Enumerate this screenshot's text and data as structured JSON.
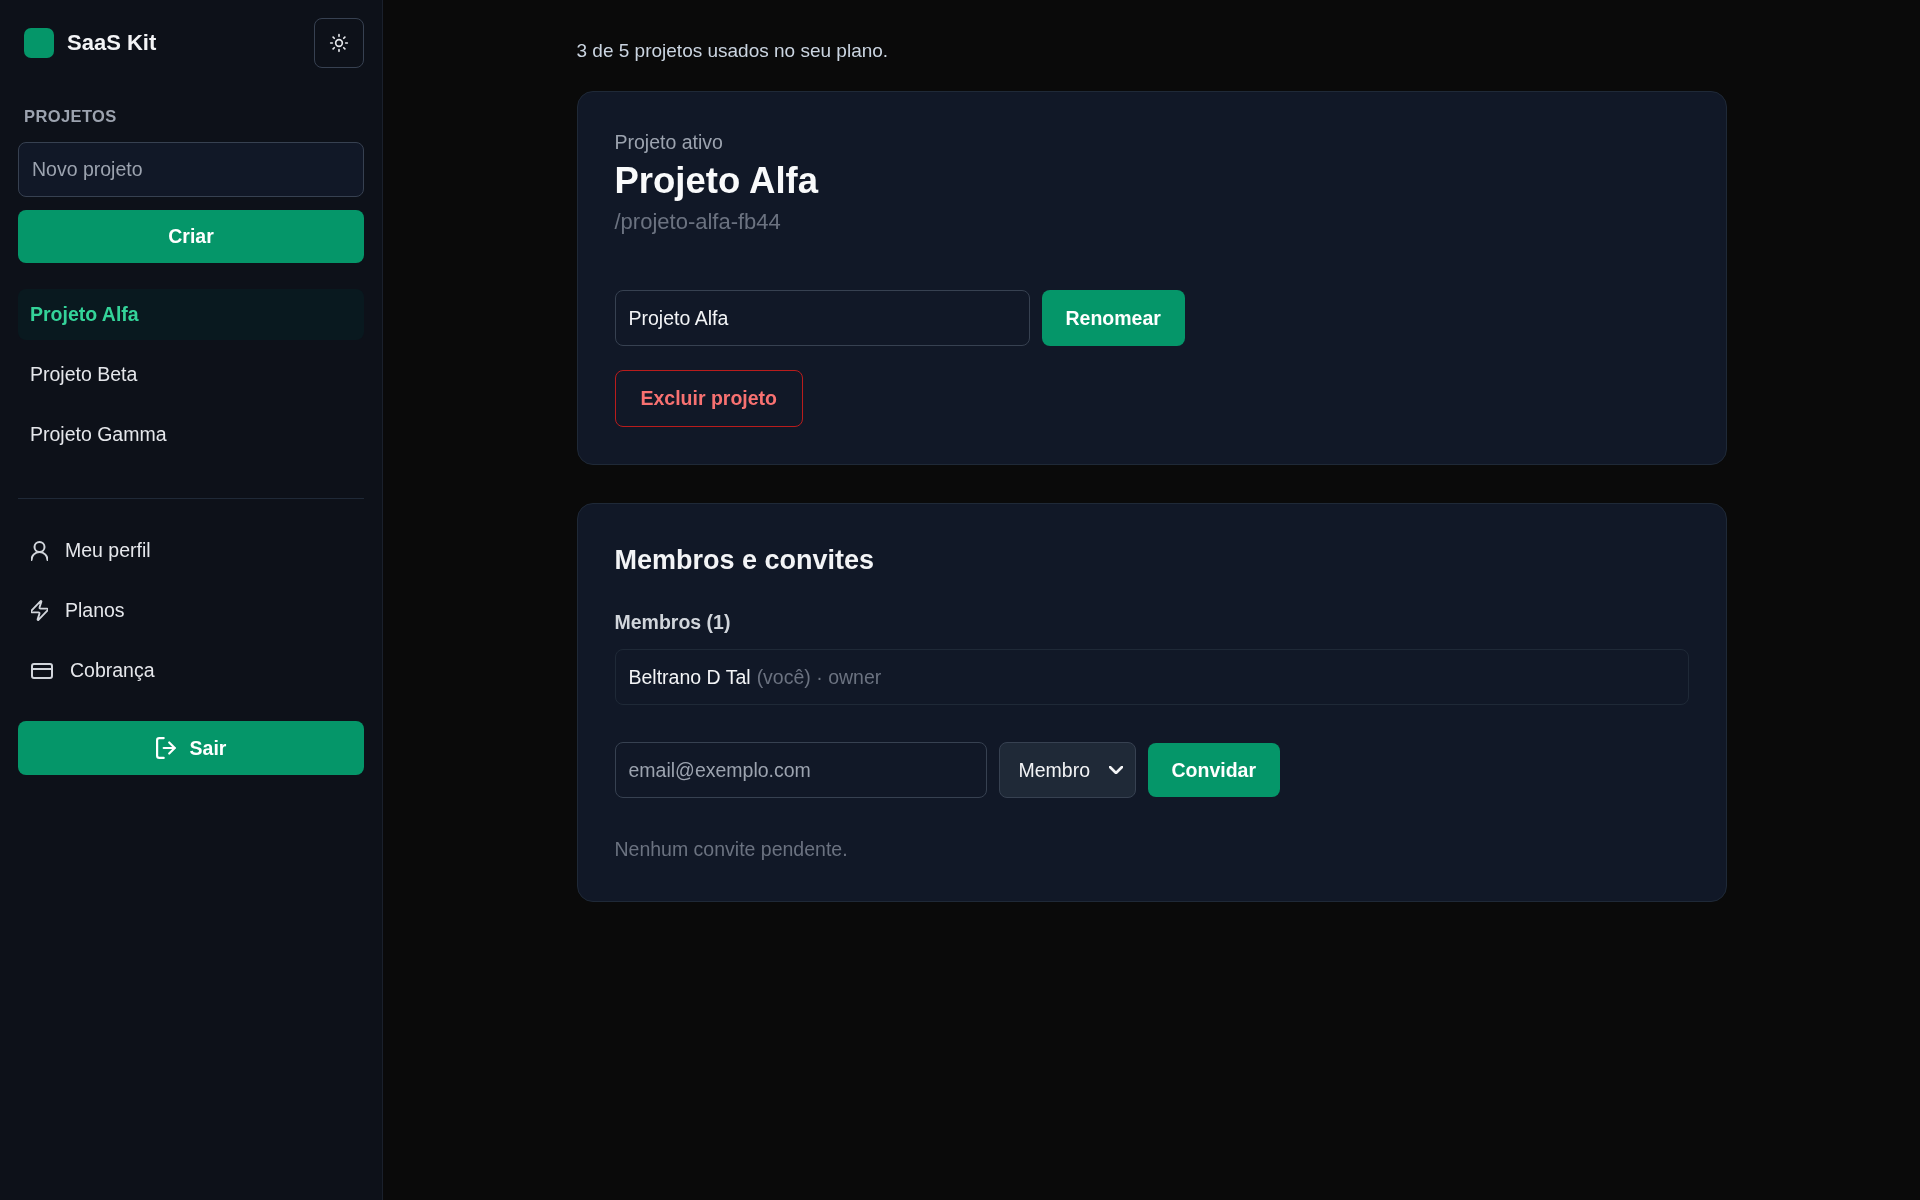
{
  "sidebar": {
    "brand": "SaaS Kit",
    "section_label": "PROJETOS",
    "new_project": {
      "placeholder": "Novo projeto"
    },
    "create_button": "Criar",
    "projects": [
      {
        "label": "Projeto Alfa",
        "selected": true
      },
      {
        "label": "Projeto Beta",
        "selected": false
      },
      {
        "label": "Projeto Gamma",
        "selected": false
      }
    ],
    "nav": [
      {
        "label": "Meu perfil"
      },
      {
        "label": "Planos"
      },
      {
        "label": "Cobrança"
      }
    ],
    "logout_button": "Sair"
  },
  "usage_note": "3 de 5 projetos usados no seu plano.",
  "project_card": {
    "eyebrow": "Projeto ativo",
    "title": "Projeto Alfa",
    "slug": "/projeto-alfa-fb44",
    "name_field": {
      "value": "Projeto Alfa"
    },
    "rename_button": "Renomear",
    "delete_button": "Excluir projeto"
  },
  "members_card": {
    "title": "Membros e convites",
    "members_heading": "Membros (1)",
    "members": [
      {
        "name": "Beltrano D Tal",
        "note": "(você) · owner"
      }
    ],
    "invite": {
      "email_field": {
        "placeholder": "email@exemplo.com"
      },
      "role_select": "Membro",
      "button": "Convidar"
    },
    "empty_invites": "Nenhum convite pendente."
  }
}
